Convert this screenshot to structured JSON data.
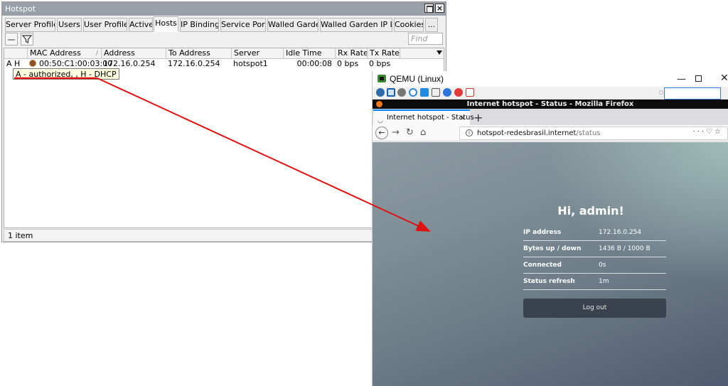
{
  "hotspot": {
    "title": "Hotspot",
    "tabs": [
      {
        "label": "Server Profiles"
      },
      {
        "label": "Users"
      },
      {
        "label": "User Profiles"
      },
      {
        "label": "Active"
      },
      {
        "label": "Hosts"
      },
      {
        "label": "IP Bindings"
      },
      {
        "label": "Service Ports"
      },
      {
        "label": "Walled Garden"
      },
      {
        "label": "Walled Garden IP List"
      },
      {
        "label": "Cookies"
      },
      {
        "label": "..."
      }
    ],
    "active_tab": "Hosts",
    "find_placeholder": "Find",
    "columns": [
      "MAC Address",
      "Address",
      "To Address",
      "Server",
      "Idle Time",
      "Rx Rate",
      "Tx Rate"
    ],
    "rows": [
      {
        "flags": "A H",
        "mac": "00:50:C1:00:03:00",
        "address": "172.16.0.254",
        "to_address": "172.16.0.254",
        "server": "hotspot1",
        "idle_time": "00:00:08",
        "rx_rate": "0 bps",
        "tx_rate": "0 bps"
      }
    ],
    "tooltip": "A - authorized,  , H - DHCP",
    "status": "1 item"
  },
  "qemu": {
    "title": "QEMU (Linux)",
    "min_glyph": "—",
    "close_glyph": "✕"
  },
  "firefox": {
    "window_title": "Internet hotspot - Status - Mozilla Firefox",
    "tab_title": "Internet hotspot - Status",
    "url_host": "hotspot-redesbrasil.internet",
    "url_path": "/status"
  },
  "status_page": {
    "greeting": "Hi, admin!",
    "rows": [
      {
        "label": "IP address",
        "value": "172.16.0.254"
      },
      {
        "label": "Bytes up / down",
        "value": "1436 B / 1000 B"
      },
      {
        "label": "Connected",
        "value": "0s"
      },
      {
        "label": "Status refresh",
        "value": "1m"
      }
    ],
    "logout_label": "Log out"
  },
  "colors": {
    "annotation": "#e01010",
    "tooltip_bg": "#ffffe1",
    "firefox_accent": "#0a84ff",
    "logout_bg": "#3a434d"
  },
  "icons": [
    "filter-icon",
    "minus-icon",
    "host-status-icon",
    "qemu-logo-icon",
    "firefox-logo-icon",
    "info-icon",
    "reload-icon",
    "home-icon",
    "back-arrow-icon",
    "forward-arrow-icon",
    "pocket-icon",
    "star-icon"
  ]
}
